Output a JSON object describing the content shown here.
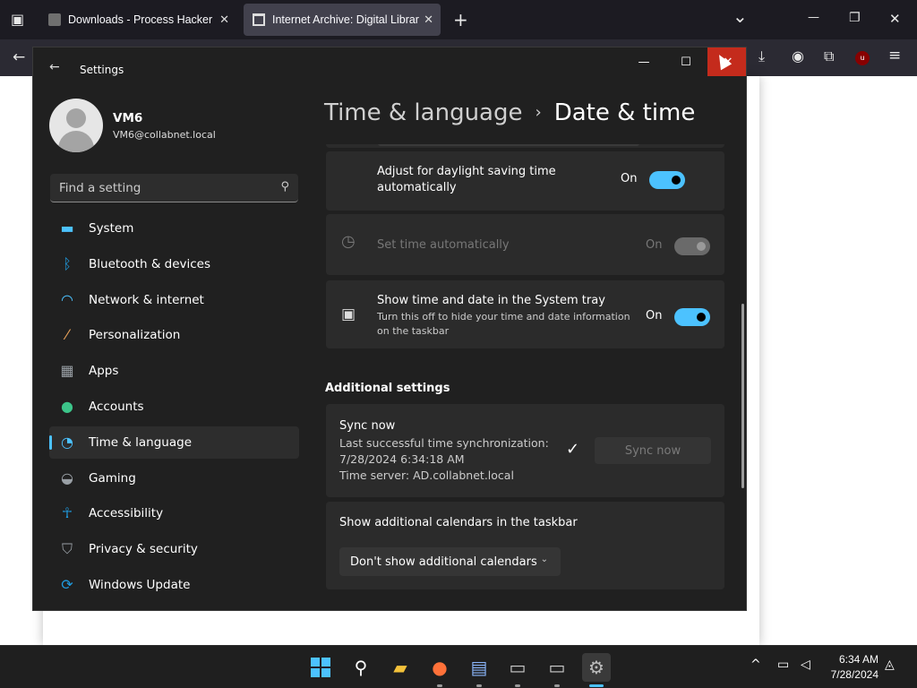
{
  "browser": {
    "tabs": [
      {
        "label": "Downloads - Process Hacker"
      },
      {
        "label": "Internet Archive: Digital Library"
      }
    ],
    "tab_close": "✕",
    "new_tab": "+",
    "list_all_tabs": "⌄",
    "window_min": "—",
    "window_restore": "❐",
    "window_close": "✕",
    "back": "←",
    "toolbar_icons": [
      "download-icon",
      "account-icon",
      "extensions-icon",
      "ublock-icon",
      "menu-icon"
    ]
  },
  "settings": {
    "window_title": "Settings",
    "back_arrow": "←",
    "min": "—",
    "max": "☐",
    "close": "✕",
    "user": {
      "name": "VM6",
      "email": "VM6@collabnet.local"
    },
    "search_placeholder": "Find a setting",
    "nav": [
      {
        "label": "System",
        "icon": "system-icon",
        "color": "#4cc2ff"
      },
      {
        "label": "Bluetooth & devices",
        "icon": "bluetooth-icon",
        "color": "#0078d4"
      },
      {
        "label": "Network & internet",
        "icon": "wifi-icon",
        "color": "#4cc2ff"
      },
      {
        "label": "Personalization",
        "icon": "brush-icon",
        "color": "#e8a25a"
      },
      {
        "label": "Apps",
        "icon": "apps-icon",
        "color": "#9aa0a6"
      },
      {
        "label": "Accounts",
        "icon": "accounts-icon",
        "color": "#3cc58a"
      },
      {
        "label": "Time & language",
        "icon": "globe-clock-icon",
        "color": "#4cc2ff",
        "active": true
      },
      {
        "label": "Gaming",
        "icon": "gamepad-icon",
        "color": "#9aa0a6"
      },
      {
        "label": "Accessibility",
        "icon": "accessibility-icon",
        "color": "#1f9be0"
      },
      {
        "label": "Privacy & security",
        "icon": "shield-icon",
        "color": "#9aa0a6"
      },
      {
        "label": "Windows Update",
        "icon": "update-icon",
        "color": "#1f9be0"
      }
    ],
    "breadcrumb": {
      "parent": "Time & language",
      "separator": "›",
      "current": "Date & time"
    },
    "cards": {
      "daylight": {
        "label_line1": "Adjust for daylight saving time",
        "label_line2": "automatically",
        "state": "On"
      },
      "set_time": {
        "label": "Set time automatically",
        "state": "On"
      },
      "tray": {
        "label": "Show time and date in the System tray",
        "sub_line1": "Turn this off to hide your time and date information",
        "sub_line2": "on the taskbar",
        "state": "On"
      }
    },
    "additional_heading": "Additional settings",
    "sync": {
      "label": "Sync now",
      "line1": "Last successful time synchronization:",
      "line2": "7/28/2024 6:34:18 AM",
      "line3": "Time server: AD.collabnet.local",
      "check": "✓",
      "button": "Sync now"
    },
    "calendars": {
      "label": "Show additional calendars in the taskbar",
      "dropdown_value": "Don't show additional calendars",
      "chevron": "⌄"
    }
  },
  "taskbar": {
    "apps": [
      "start-icon",
      "search-icon",
      "file-explorer-icon",
      "firefox-icon",
      "remote-desktop-icon",
      "terminal-icon",
      "powershell-icon",
      "settings-icon"
    ],
    "tray_up": "^",
    "time": "6:34 AM",
    "date": "7/28/2024"
  },
  "colors": {
    "accent": "#4cc2ff",
    "close_red": "#c42b1c",
    "dark_bg": "#202020",
    "card_bg": "#2b2b2b"
  }
}
